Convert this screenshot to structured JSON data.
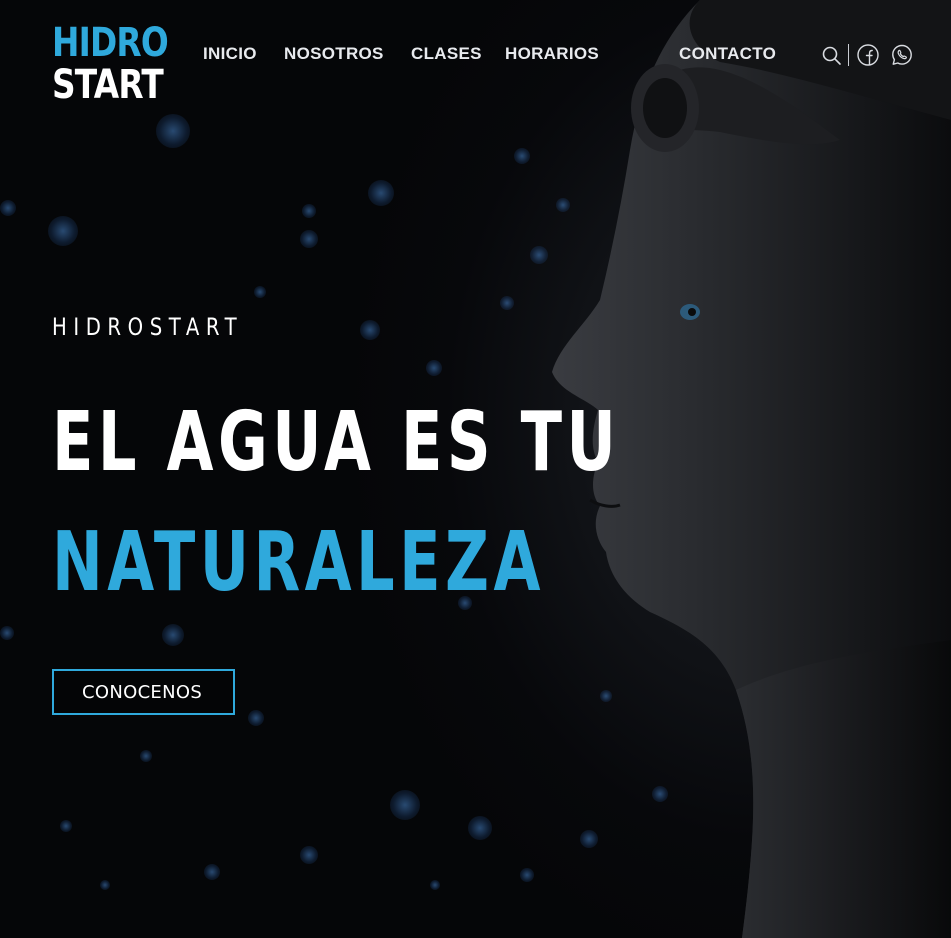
{
  "brand": {
    "line1": "HIDRO",
    "line2": "START"
  },
  "nav": {
    "items": [
      {
        "label": "INICIO"
      },
      {
        "label": "NOSOTROS"
      },
      {
        "label": "CLASES"
      },
      {
        "label": "HORARIOS"
      },
      {
        "label": "CONTACTO"
      }
    ]
  },
  "header_icons": [
    "search-icon",
    "facebook-icon",
    "whatsapp-icon"
  ],
  "hero": {
    "eyebrow": "HIDROSTART",
    "headline_line1": "EL AGUA ES TU",
    "headline_line2": "NATURALEZA",
    "cta_label": "CONOCENOS"
  },
  "colors": {
    "accent": "#2fa9dc",
    "text": "#ffffff",
    "background": "#050608"
  }
}
